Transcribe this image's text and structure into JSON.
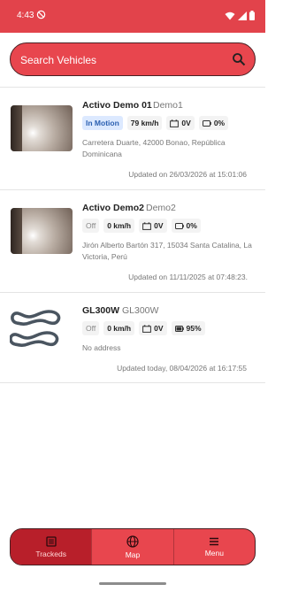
{
  "status_bar": {
    "time": "4:43",
    "icons": [
      "sync-off-icon",
      "wifi-icon",
      "signal-icon",
      "battery-icon"
    ]
  },
  "search": {
    "placeholder": "Search Vehicles",
    "icon": "search-icon"
  },
  "vehicles": [
    {
      "name": "Activo Demo 01",
      "plate": "Demo1",
      "status": "In Motion",
      "speed": "79 km/h",
      "voltage": "0V",
      "battery": "0%",
      "address": "Carretera Duarte, 42000 Bonao, República Dominicana",
      "updated": "Updated on 26/03/2026 at 15:01:06"
    },
    {
      "name": "Activo Demo2",
      "plate": "Demo2",
      "status": "Off",
      "speed": "0 km/h",
      "voltage": "0V",
      "battery": "0%",
      "address": "Jirón Alberto Bartón 317, 15034 Santa Catalina, La Victoria, Perú",
      "updated": "Updated on 11/11/2025 at 07:48:23."
    },
    {
      "name": "GL300W",
      "plate": "GL300W",
      "status": "Off",
      "speed": "0 km/h",
      "voltage": "0V",
      "battery": "95%",
      "address": "No address",
      "updated": "Updated today, 08/04/2026 at 16:17:55"
    }
  ],
  "bottom_nav": {
    "items": [
      {
        "label": "Trackeds",
        "icon": "list-icon",
        "active": true
      },
      {
        "label": "Map",
        "icon": "globe-icon",
        "active": false
      },
      {
        "label": "Menu",
        "icon": "menu-icon",
        "active": false
      }
    ]
  },
  "colors": {
    "primary": "#e2434b",
    "active_nav": "#b81f2a",
    "motion_chip": "#dce9ff"
  }
}
